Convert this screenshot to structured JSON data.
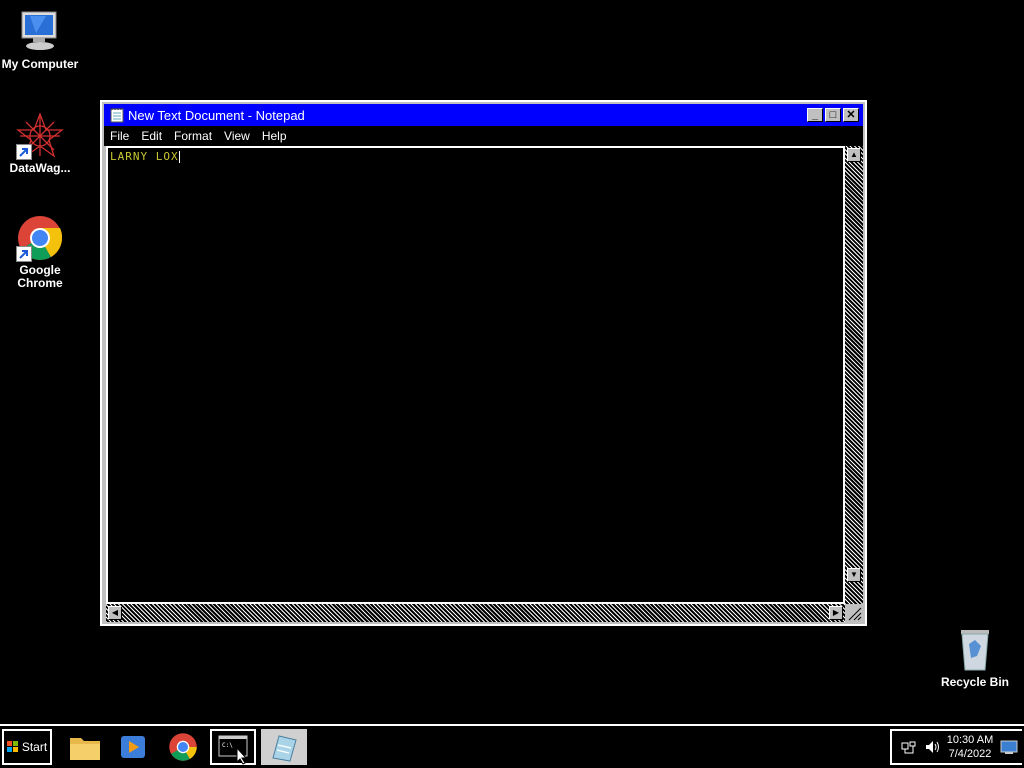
{
  "desktop": {
    "icons": [
      {
        "label": "My Computer"
      },
      {
        "label": "DataWag..."
      },
      {
        "label": "Google Chrome"
      },
      {
        "label": "Recycle Bin"
      }
    ]
  },
  "window": {
    "title": "New Text Document - Notepad",
    "menu": [
      "File",
      "Edit",
      "Format",
      "View",
      "Help"
    ],
    "content": "LARNY LOX",
    "controls": {
      "minimize": "_",
      "maximize": "□",
      "close": "✕"
    }
  },
  "taskbar": {
    "start_label": "Start",
    "apps": [
      "file-explorer",
      "media-player",
      "google-chrome",
      "command-prompt",
      "notepad"
    ],
    "clock": {
      "time": "10:30 AM",
      "date": "7/4/2022"
    }
  },
  "colors": {
    "titlebar": "#0000ff",
    "text": "#c8c832",
    "background": "#000000"
  }
}
